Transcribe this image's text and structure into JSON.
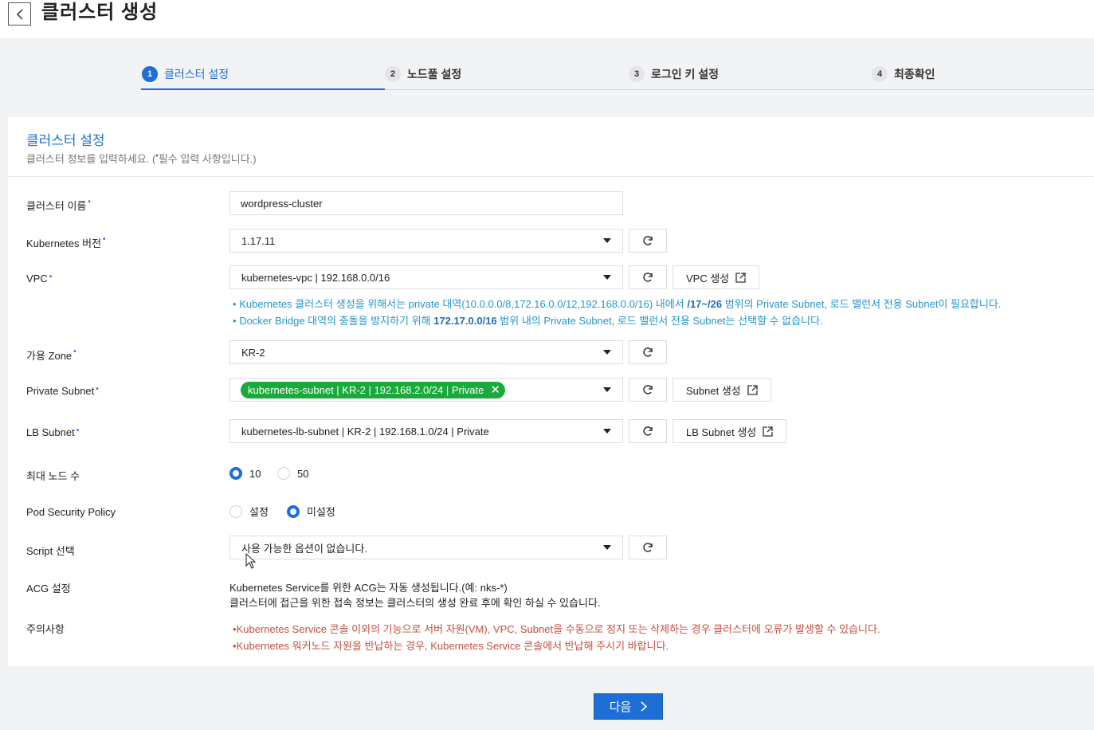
{
  "header": {
    "title": "클러스터 생성"
  },
  "steps": [
    {
      "num": "1",
      "label": "클러스터 설정"
    },
    {
      "num": "2",
      "label": "노드풀 설정"
    },
    {
      "num": "3",
      "label": "로그인 키 설정"
    },
    {
      "num": "4",
      "label": "최종확인"
    }
  ],
  "section": {
    "title": "클러스터 설정",
    "desc_prefix": "클러스터 정보를 입력하세요. (",
    "required_dot": "•",
    "desc_suffix": "필수 입력 사항입니다.)"
  },
  "form": {
    "cluster_name": {
      "label": "클러스터 이름",
      "value": "wordpress-cluster"
    },
    "k8s_version": {
      "label": "Kubernetes 버전",
      "value": "1.17.11"
    },
    "vpc": {
      "label": "VPC",
      "value": "kubernetes-vpc | 192.168.0.0/16",
      "create_label": "VPC 생성",
      "note1_a": "Kubernetes 클러스터 생성을 위해서는 private 대역(10.0.0.0/8,172.16.0.0/12,192.168.0.0/16) 내에서 ",
      "note1_b": "/17~/26",
      "note1_c": " 범위의 Private Subnet, 로드 밸런서 전용 Subnet이 필요합니다.",
      "note2_a": "Docker Bridge 대역의 충돌을 방지하기 위해 ",
      "note2_b": "172.17.0.0/16",
      "note2_c": " 범위 내의 Private Subnet, 로드 밸런서 전용 Subnet는 선택할 수 없습니다."
    },
    "zone": {
      "label": "가용 Zone",
      "value": "KR-2"
    },
    "private_subnet": {
      "label": "Private Subnet",
      "tag": "kubernetes-subnet | KR-2 | 192.168.2.0/24 | Private",
      "create_label": "Subnet 생성"
    },
    "lb_subnet": {
      "label": "LB Subnet",
      "value": "kubernetes-lb-subnet | KR-2 | 192.168.1.0/24 | Private",
      "create_label": "LB Subnet 생성"
    },
    "max_nodes": {
      "label": "최대 노드 수",
      "options": [
        "10",
        "50"
      ],
      "selected": "10"
    },
    "pod_security": {
      "label": "Pod Security Policy",
      "options": [
        "설정",
        "미설정"
      ],
      "selected": "미설정"
    },
    "script": {
      "label": "Script 선택",
      "value": "사용 가능한 옵션이 없습니다."
    },
    "acg": {
      "label": "ACG 설정",
      "line1": "Kubernetes Service를 위한 ACG는 자동 생성됩니다.(예: nks-*)",
      "line2": "클러스터에 접근을 위한 접속 정보는 클러스터의 생성 완료 후에 확인 하실 수 있습니다."
    },
    "caution": {
      "label": "주의사항",
      "line1": "Kubernetes Service 콘솔 이외의 기능으로 서버 자원(VM), VPC, Subnet을 수동으로 정지 또는 삭제하는 경우 클러스터에 오류가 발생할 수 있습니다.",
      "line2": "Kubernetes 워커노드 자원을 반납하는 경우, Kubernetes Service 콘솔에서 반납해 주시기 바랍니다."
    }
  },
  "footer": {
    "next_label": "다음"
  },
  "colors": {
    "accent": "#1d6fd6",
    "tag_green": "#1aa93b",
    "note_blue": "#2795c8",
    "warn_red": "#c2503f"
  }
}
